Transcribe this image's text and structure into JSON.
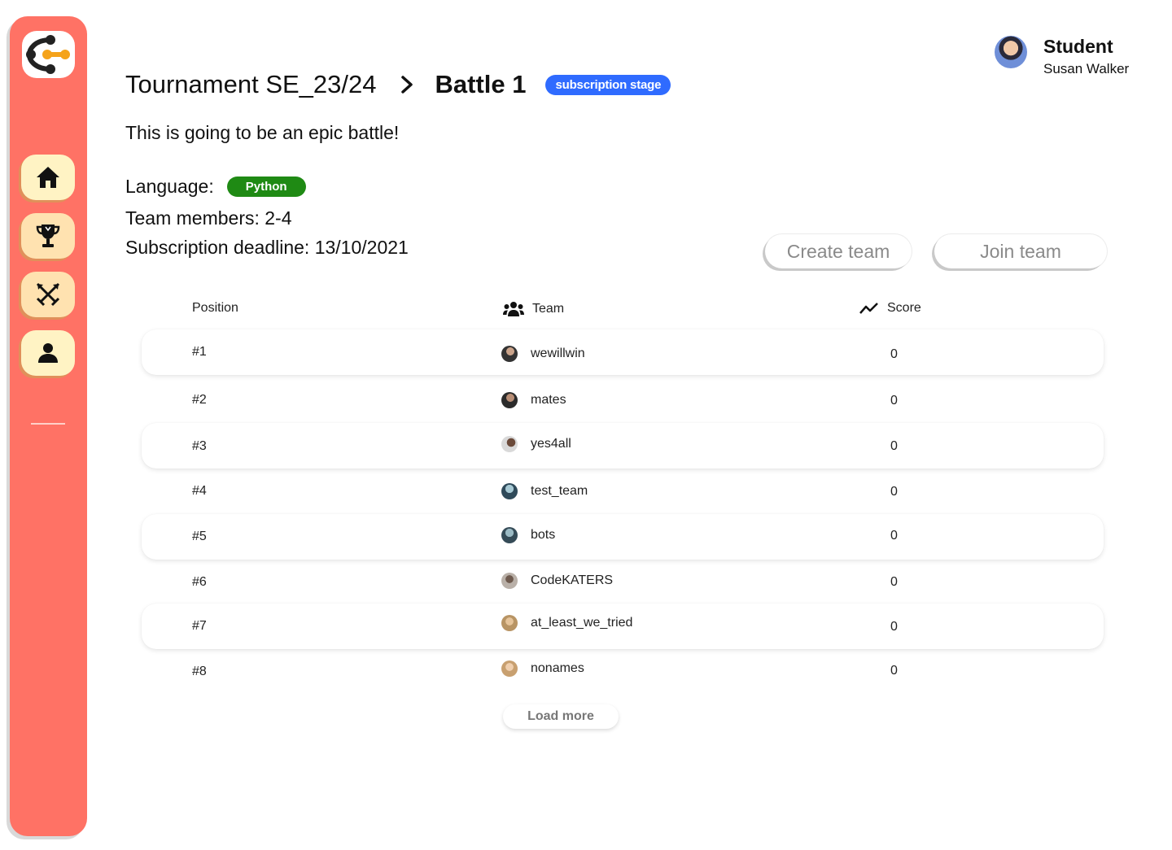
{
  "header": {
    "tournament": "Tournament SE_23/24",
    "battle": "Battle 1",
    "stage_badge": "subscription stage"
  },
  "description": "This is going to be an epic battle!",
  "info": {
    "language_label": "Language:",
    "language_value": "Python",
    "team_members": "Team members: 2-4",
    "deadline": "Subscription deadline: 13/10/2021"
  },
  "user": {
    "role": "Student",
    "name": "Susan Walker"
  },
  "actions": {
    "create_team": "Create team",
    "join_team": "Join team",
    "load_more": "Load more"
  },
  "sidebar": {
    "items": [
      "home-icon",
      "trophy-icon",
      "swords-icon",
      "profile-icon"
    ]
  },
  "table": {
    "headers": {
      "position": "Position",
      "team": "Team",
      "score": "Score"
    },
    "rows": [
      {
        "position": "#1",
        "team": "wewillwin",
        "score": "0"
      },
      {
        "position": "#2",
        "team": "mates",
        "score": "0"
      },
      {
        "position": "#3",
        "team": "yes4all",
        "score": "0"
      },
      {
        "position": "#4",
        "team": "test_team",
        "score": "0"
      },
      {
        "position": "#5",
        "team": "bots",
        "score": "0"
      },
      {
        "position": "#6",
        "team": "CodeKATERS",
        "score": "0"
      },
      {
        "position": "#7",
        "team": "at_least_we_tried",
        "score": "0"
      },
      {
        "position": "#8",
        "team": "nonames",
        "score": "0"
      }
    ]
  },
  "colors": {
    "sidebar": "#ff7265",
    "nav_button": "#fff3c4",
    "stage_badge": "#2f6bff",
    "language_badge": "#1f8a14"
  }
}
